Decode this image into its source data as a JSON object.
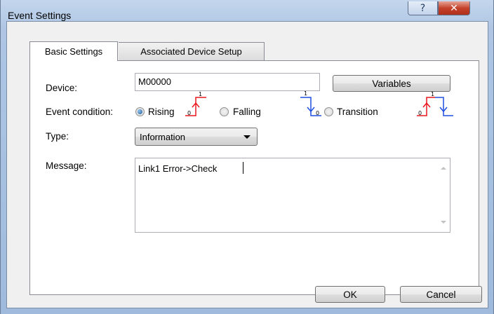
{
  "window": {
    "title": "Event Settings",
    "help_glyph": "?",
    "close_glyph": "✕"
  },
  "tabs": [
    {
      "label": "Basic Settings",
      "selected": true
    },
    {
      "label": "Associated Device Setup",
      "selected": false
    }
  ],
  "form": {
    "device_label": "Device:",
    "device_value": "M00000",
    "variables_button": "Variables",
    "event_condition_label": "Event condition:",
    "event_condition_options": [
      {
        "label": "Rising",
        "selected": true
      },
      {
        "label": "Falling",
        "selected": false
      },
      {
        "label": "Transition",
        "selected": false
      }
    ],
    "signal_marks": {
      "one": "1",
      "zero": "0"
    },
    "type_label": "Type:",
    "type_value": "Information",
    "message_label": "Message:",
    "message_value": "Link1 Error->Check"
  },
  "footer": {
    "ok_label": "OK",
    "cancel_label": "Cancel"
  },
  "colors": {
    "rising": "#e8171d",
    "falling": "#1f4fe0",
    "accent": "#1d5a9c"
  }
}
